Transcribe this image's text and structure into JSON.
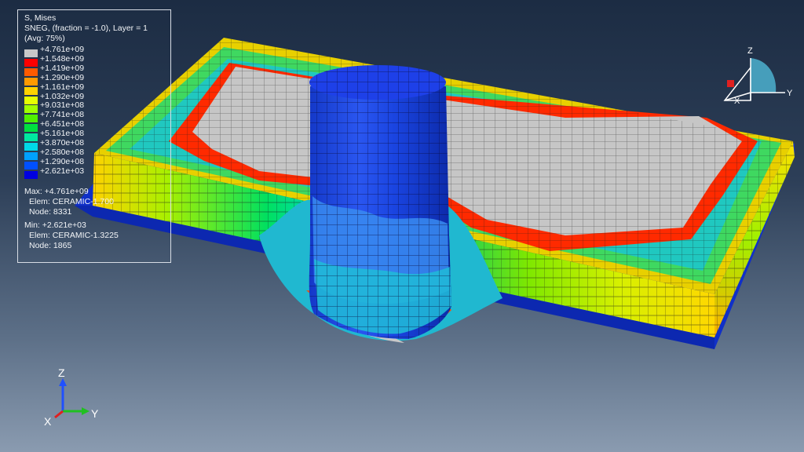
{
  "legend": {
    "title": "S, Mises",
    "subtitle": "SNEG, (fraction = -1.0), Layer = 1",
    "avg": "(Avg: 75%)",
    "entries": [
      {
        "label": "+4.761e+09",
        "color": "#c8c8c8"
      },
      {
        "label": "+1.548e+09",
        "color": "#ff0000"
      },
      {
        "label": "+1.419e+09",
        "color": "#ff5a00"
      },
      {
        "label": "+1.290e+09",
        "color": "#ff9a00"
      },
      {
        "label": "+1.161e+09",
        "color": "#ffd200"
      },
      {
        "label": "+1.032e+09",
        "color": "#e6ff00"
      },
      {
        "label": "+9.031e+08",
        "color": "#a0ff00"
      },
      {
        "label": "+7.741e+08",
        "color": "#50f000"
      },
      {
        "label": "+6.451e+08",
        "color": "#00e040"
      },
      {
        "label": "+5.161e+08",
        "color": "#00e8a0"
      },
      {
        "label": "+3.870e+08",
        "color": "#00d8e8"
      },
      {
        "label": "+2.580e+08",
        "color": "#00a0ff"
      },
      {
        "label": "+1.290e+08",
        "color": "#0050ff"
      },
      {
        "label": "+2.621e+03",
        "color": "#0000e0"
      }
    ],
    "max_label": "Max: +4.761e+09",
    "max_elem": "Elem: CERAMIC-1.700",
    "max_node": "Node: 8331",
    "min_label": "Min: +2.621e+03",
    "min_elem": "Elem: CERAMIC-1.3225",
    "min_node": "Node: 1865"
  },
  "triad": {
    "x": "X",
    "y": "Y",
    "z": "Z"
  },
  "view_cube": {
    "x": "X",
    "y": "Y",
    "z": "Z"
  },
  "colors": {
    "background_top": "#1c2c43",
    "background_bottom": "#8a9bb0",
    "projectile": "#1a3ce0",
    "plate_gray": "#c4c4c4",
    "backing_blue": "#1030c8"
  }
}
